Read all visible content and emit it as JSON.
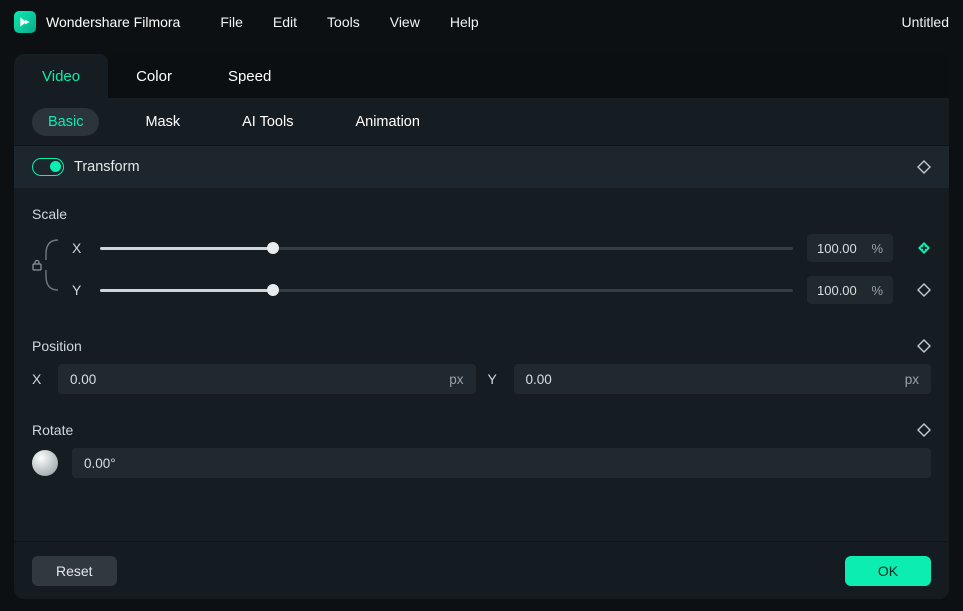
{
  "app": {
    "title": "Wondershare Filmora",
    "project": "Untitled"
  },
  "menu": {
    "file": "File",
    "edit": "Edit",
    "tools": "Tools",
    "view": "View",
    "help": "Help"
  },
  "primary_tabs": {
    "video": "Video",
    "color": "Color",
    "speed": "Speed"
  },
  "secondary_tabs": {
    "basic": "Basic",
    "mask": "Mask",
    "ai": "AI Tools",
    "animation": "Animation"
  },
  "transform": {
    "label": "Transform",
    "scale_label": "Scale",
    "scale_x_label": "X",
    "scale_y_label": "Y",
    "scale_x_value": "100.00",
    "scale_y_value": "100.00",
    "scale_unit": "%",
    "slider_percent": 25,
    "position_label": "Position",
    "position_x_label": "X",
    "position_y_label": "Y",
    "position_x_value": "0.00",
    "position_y_value": "0.00",
    "position_unit": "px",
    "rotate_label": "Rotate",
    "rotate_value": "0.00°"
  },
  "footer": {
    "reset": "Reset",
    "ok": "OK"
  },
  "colors": {
    "accent": "#0bedb1"
  }
}
